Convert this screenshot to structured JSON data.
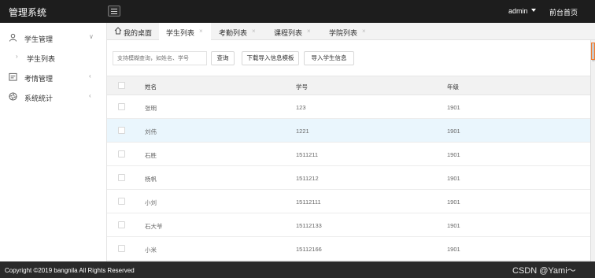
{
  "header": {
    "title": "管理系统",
    "user": "admin",
    "front_link": "前台首页"
  },
  "sidebar": {
    "items": [
      {
        "label": "学生管理",
        "icon": "user-icon",
        "expanded": true
      },
      {
        "label": "学生列表",
        "icon": "chevron-right-icon"
      },
      {
        "label": "考情管理",
        "icon": "calendar-icon",
        "expanded": false
      },
      {
        "label": "系统统计",
        "icon": "aperture-icon",
        "expanded": false
      }
    ]
  },
  "tabs": [
    {
      "label": "我的桌面",
      "icon": "home-icon"
    },
    {
      "label": "学生列表",
      "active": true
    },
    {
      "label": "考勤列表"
    },
    {
      "label": "课程列表"
    },
    {
      "label": "学院列表"
    }
  ],
  "toolbar": {
    "search_placeholder": "支持模糊查询，如姓名、学号",
    "query_label": "查询",
    "download_label": "下载导入信息模板",
    "import_label": "导入学生信息"
  },
  "table": {
    "columns": [
      "姓名",
      "学号",
      "年级"
    ],
    "rows": [
      [
        "张明",
        "123",
        "1901"
      ],
      [
        "刘伟",
        "1221",
        "1901"
      ],
      [
        "石胜",
        "1511211",
        "1901"
      ],
      [
        "杨帆",
        "1511212",
        "1901"
      ],
      [
        "小刘",
        "15112111",
        "1901"
      ],
      [
        "石大爷",
        "15112133",
        "1901"
      ],
      [
        "小米",
        "15112166",
        "1901"
      ]
    ],
    "hovered_row": 1
  },
  "footer": {
    "copyright": "Copyright ©2019 bangnila All Rights Reserved",
    "watermark": "CSDN @Yami～"
  },
  "colors": {
    "topbar": "#1d1d1d",
    "row_hover": "#eaf6fd",
    "footer": "#2a2a2a"
  }
}
